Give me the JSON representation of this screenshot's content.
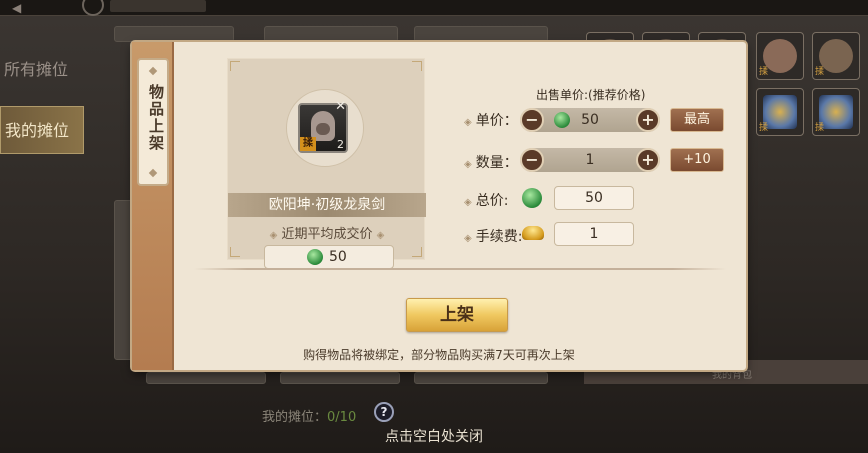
{
  "background": {
    "tabs": [
      {
        "label": "所有摊位",
        "active": false
      },
      {
        "label": "我的摊位",
        "active": true
      }
    ],
    "stall_count_label": "我的摊位：",
    "stall_count_value": "0/10",
    "help_icon": "question-icon",
    "close_hint": "点击空白处关闭"
  },
  "dialog": {
    "side_tab_label": "物品上架",
    "item": {
      "name": "欧阳坤·初级龙泉剑",
      "quantity": "2",
      "grade_tag": "揉",
      "icon": "hooded-character-icon"
    },
    "avg_label": "近期平均成交价",
    "avg_price": "50",
    "sell_header": "出售单价:(推荐价格)",
    "unit_price_label": "单价：",
    "unit_price": "50",
    "max_button": "最高",
    "quantity_label": "数量：",
    "quantity": "1",
    "plus10_button": "+10",
    "total_label": "总价:",
    "total_value": "50",
    "fee_label": "手续费:",
    "fee_value": "1",
    "list_button": "上架",
    "footer_note": "购得物品将被绑定，部分物品购买满7天可再次上架",
    "currency_icon": "jade-coin-icon",
    "fee_icon": "gold-ingot-icon"
  },
  "colors": {
    "dialog_bg": "#efe5d4",
    "accent_brown": "#7a4a30",
    "gold_button": "#f0c860"
  }
}
